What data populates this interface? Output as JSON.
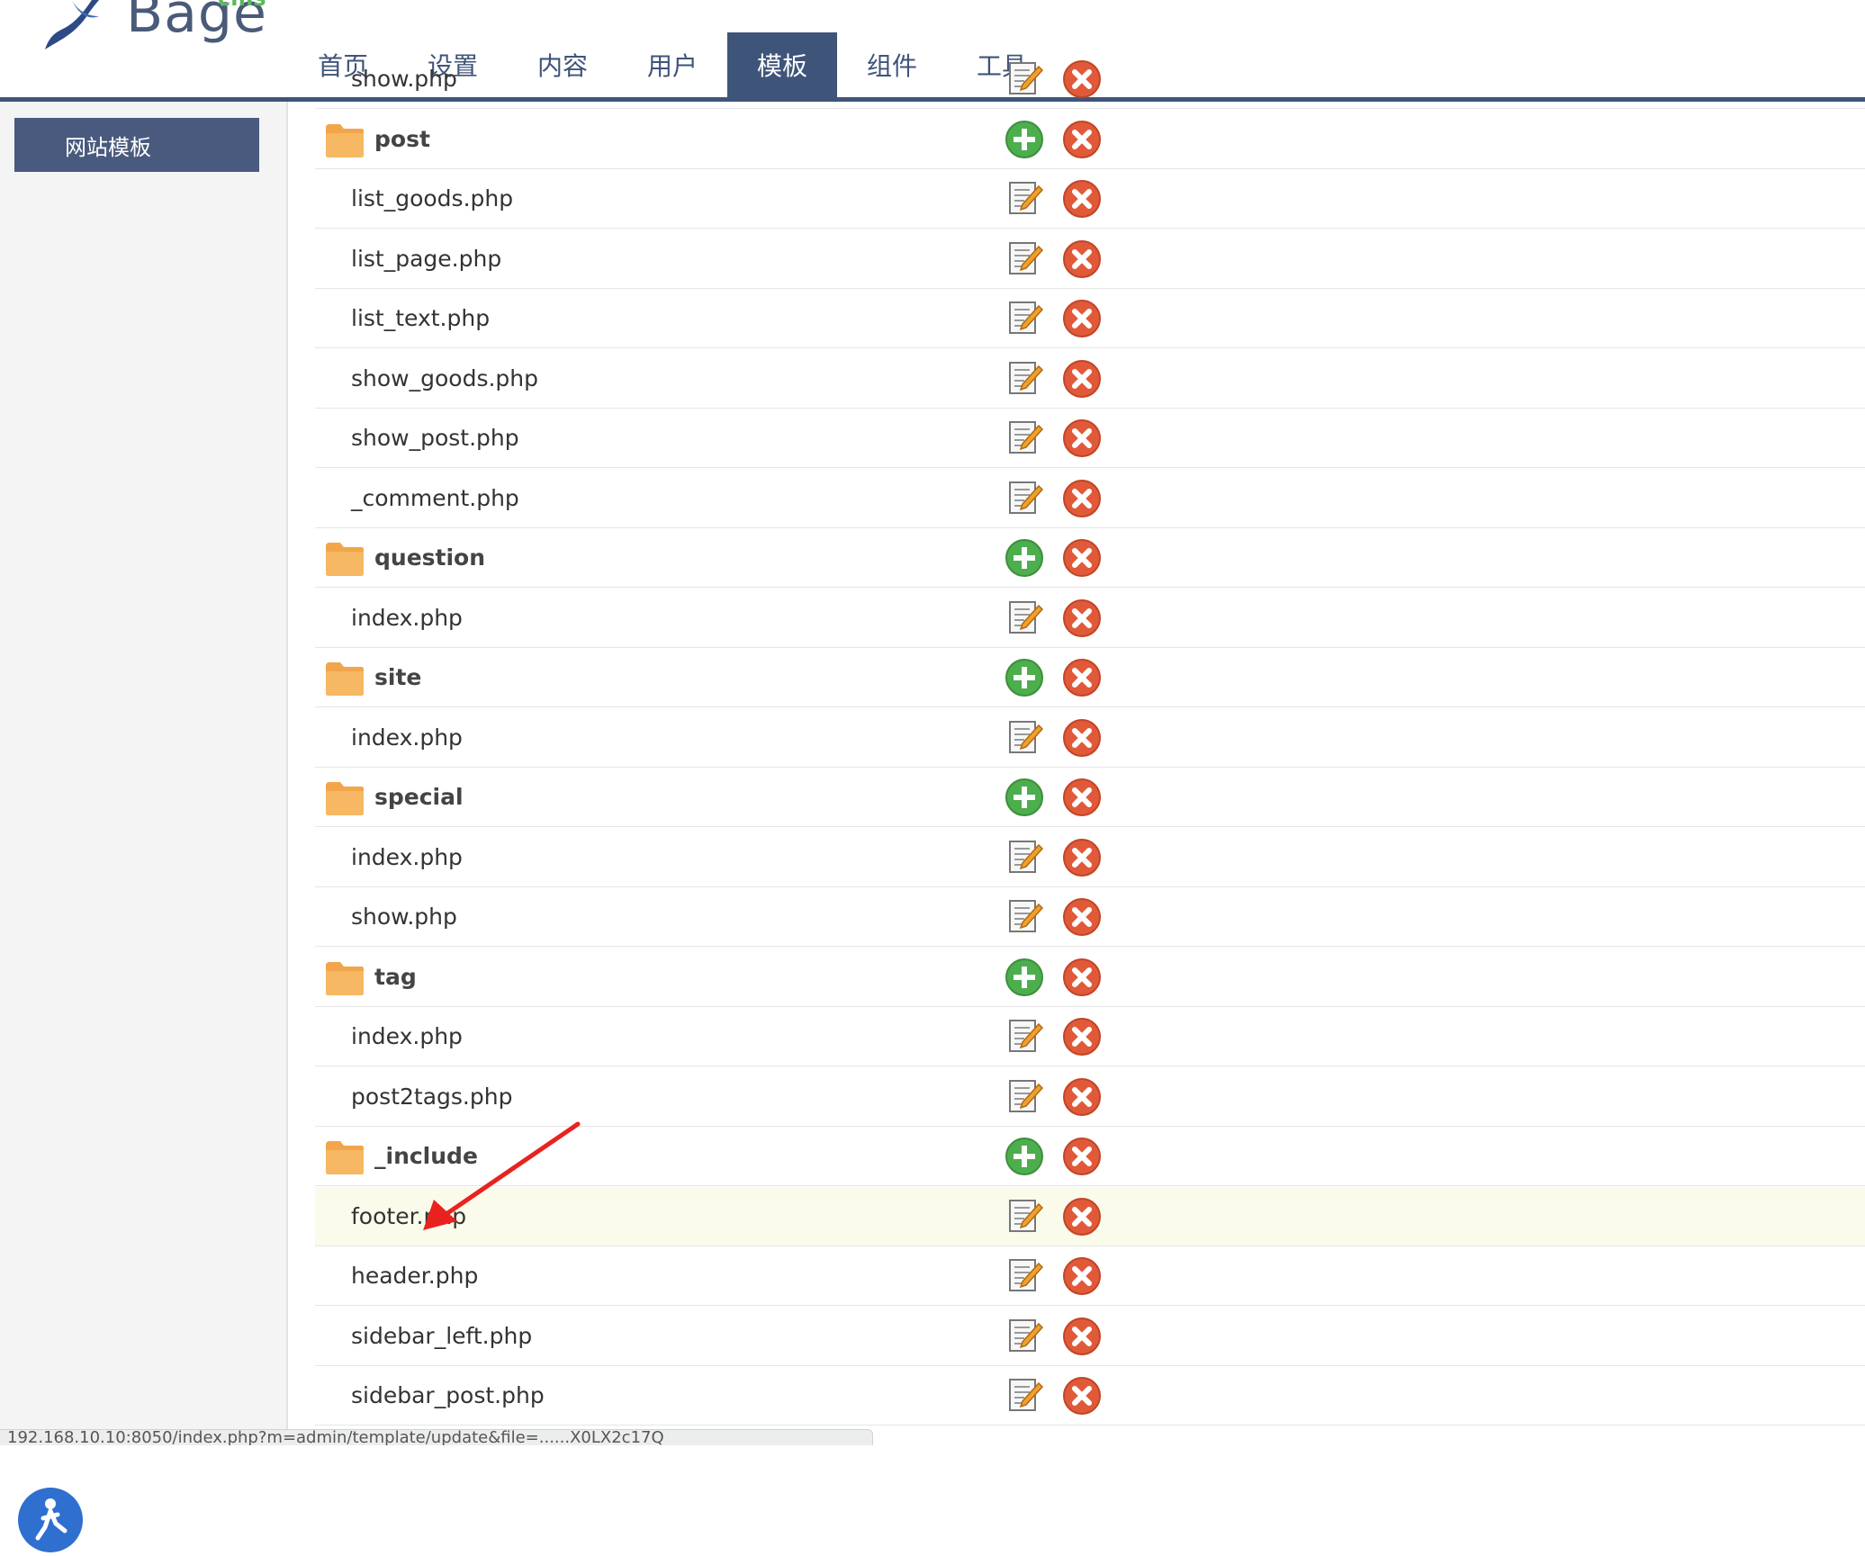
{
  "logo": {
    "text": "Bage",
    "sub": "cms"
  },
  "nav": {
    "items": [
      {
        "label": "首页",
        "active": false
      },
      {
        "label": "设置",
        "active": false
      },
      {
        "label": "内容",
        "active": false
      },
      {
        "label": "用户",
        "active": false
      },
      {
        "label": "模板",
        "active": true
      },
      {
        "label": "组件",
        "active": false
      },
      {
        "label": "工具",
        "active": false
      }
    ]
  },
  "sidebar": {
    "button_label": "网站模板"
  },
  "files": [
    {
      "type": "file",
      "name": "show.php"
    },
    {
      "type": "folder",
      "name": "post"
    },
    {
      "type": "file",
      "name": "list_goods.php"
    },
    {
      "type": "file",
      "name": "list_page.php"
    },
    {
      "type": "file",
      "name": "list_text.php"
    },
    {
      "type": "file",
      "name": "show_goods.php"
    },
    {
      "type": "file",
      "name": "show_post.php"
    },
    {
      "type": "file",
      "name": "_comment.php"
    },
    {
      "type": "folder",
      "name": "question"
    },
    {
      "type": "file",
      "name": "index.php"
    },
    {
      "type": "folder",
      "name": "site"
    },
    {
      "type": "file",
      "name": "index.php"
    },
    {
      "type": "folder",
      "name": "special"
    },
    {
      "type": "file",
      "name": "index.php"
    },
    {
      "type": "file",
      "name": "show.php"
    },
    {
      "type": "folder",
      "name": "tag"
    },
    {
      "type": "file",
      "name": "index.php"
    },
    {
      "type": "file",
      "name": "post2tags.php"
    },
    {
      "type": "folder",
      "name": "_include"
    },
    {
      "type": "file",
      "name": "footer.php",
      "highlighted": true
    },
    {
      "type": "file",
      "name": "header.php"
    },
    {
      "type": "file",
      "name": "sidebar_left.php"
    },
    {
      "type": "file",
      "name": "sidebar_post.php"
    }
  ],
  "status_bar": {
    "url": "192.168.10.10:8050/index.php?m=admin/template/update&file=......X0LX2c17Q"
  },
  "colors": {
    "nav_active": "#3f5479",
    "add_icon": "#4cae4c",
    "delete_icon": "#e05a3a",
    "folder": "#f2a54a",
    "highlight_row": "#fbfbeb",
    "arrow": "#e8231f"
  },
  "icons": {
    "folder": "folder-icon",
    "add": "add-circle-icon",
    "delete": "delete-circle-icon",
    "edit": "edit-file-icon"
  }
}
